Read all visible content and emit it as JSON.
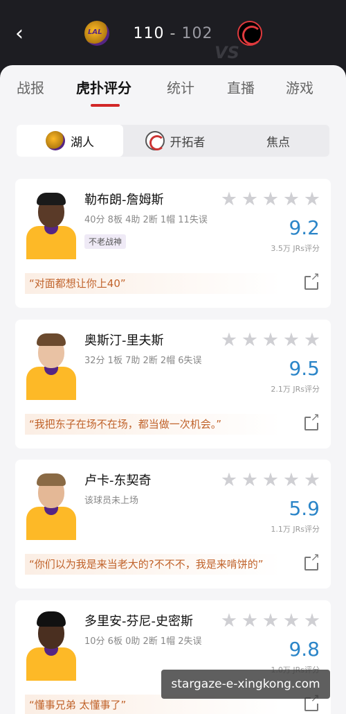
{
  "header": {
    "back_icon": "‹",
    "home_team_logo": "lakers-logo",
    "away_team_logo": "blazers-logo",
    "score_home": "110",
    "score_separator": "-",
    "score_away": "102",
    "vs": "VS"
  },
  "tabs": [
    {
      "label": "战报"
    },
    {
      "label": "虎扑评分",
      "active": true
    },
    {
      "label": "统计"
    },
    {
      "label": "直播"
    },
    {
      "label": "游戏"
    }
  ],
  "team_segment": [
    {
      "label": "湖人",
      "active": true
    },
    {
      "label": "开拓者"
    },
    {
      "label": "焦点"
    }
  ],
  "players": [
    {
      "name": "勒布朗-詹姆斯",
      "stats": "40分 8板 4助 2断 1帽 11失误",
      "tag": "不老战神",
      "rating": "9.2",
      "votes": "3.5万 JRs评分",
      "quote": "“对面都想让你上40”"
    },
    {
      "name": "奥斯汀-里夫斯",
      "stats": "32分 1板 7助 2断 2帽 6失误",
      "rating": "9.5",
      "votes": "2.1万 JRs评分",
      "quote": "“我把东子在场不在场，都当做一次机会。”"
    },
    {
      "name": "卢卡-东契奇",
      "stats": "该球员未上场",
      "rating": "5.9",
      "votes": "1.1万 JRs评分",
      "quote": "“你们以为我是来当老大的?不不不，我是来啃饼的”"
    },
    {
      "name": "多里安-芬尼-史密斯",
      "stats": "10分 6板 0助 2断 1帽 2失误",
      "rating": "9.8",
      "votes": "1.0万 JRs评分",
      "quote": "“懂事兄弟 太懂事了”"
    }
  ],
  "star_glyph": "★",
  "watermark": "stargaze-e-xingkong.com",
  "colors": {
    "accent_red": "#d22727",
    "rating_blue": "#2b85c8",
    "quote_text": "#c0622a",
    "header_bg": "#1d1d22"
  }
}
